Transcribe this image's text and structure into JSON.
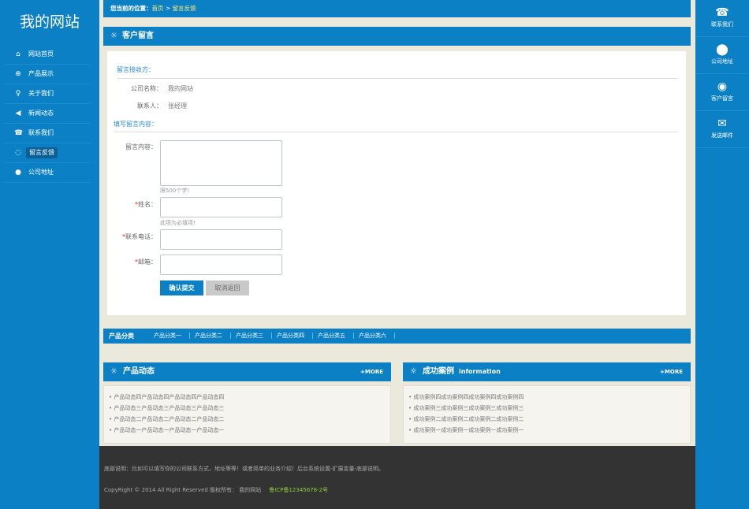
{
  "site": {
    "title": "我的网站"
  },
  "nav": [
    {
      "icon": "home-icon",
      "glyph": "⌂",
      "label": "网站首页"
    },
    {
      "icon": "globe-icon",
      "glyph": "⊕",
      "label": "产品展示"
    },
    {
      "icon": "bulb-icon",
      "glyph": "♀",
      "label": "关于我们"
    },
    {
      "icon": "speaker-icon",
      "glyph": "◀",
      "label": "新闻动态"
    },
    {
      "icon": "phone-icon",
      "glyph": "☎",
      "label": "联系我们"
    },
    {
      "icon": "chat-icon",
      "glyph": "◌",
      "label": "留言反馈",
      "active": true
    },
    {
      "icon": "location-pin-icon",
      "glyph": "●",
      "label": "公司地址"
    }
  ],
  "right_bar": [
    {
      "icon": "phone-icon",
      "glyph": "☎",
      "label": "联系我们"
    },
    {
      "icon": "location-pin-icon",
      "glyph": "⬤",
      "label": "公司地址"
    },
    {
      "icon": "chat-bubble-icon",
      "glyph": "◉",
      "label": "客户留言"
    },
    {
      "icon": "mail-icon",
      "glyph": "✉",
      "label": "发送邮件"
    }
  ],
  "breadcrumb": {
    "prefix": "您当前的位置：",
    "home": "首页",
    "sep": " > ",
    "current": "留言反馈"
  },
  "section": {
    "title": "客户留言"
  },
  "receiver": {
    "heading": "留言接收方：",
    "company_label": "公司名称：",
    "company": "我的网站",
    "contact_label": "联系人：",
    "contact": "张经理"
  },
  "form": {
    "heading": "填写留言内容：",
    "content_label": "留言内容：",
    "content_hint": "限500个字!",
    "name_label": "姓名：",
    "name_hint": "此项为必填项!",
    "phone_label": "联系电话：",
    "email_label": "邮箱：",
    "required_mark": "*",
    "submit": "确认提交",
    "cancel": "取消返回"
  },
  "categories": {
    "title": "产品分类",
    "items": [
      "产品分类一",
      "产品分类二",
      "产品分类三",
      "产品分类四",
      "产品分类五",
      "产品分类六"
    ]
  },
  "news_box": {
    "title": "产品动态",
    "more": "+MORE",
    "items": [
      "产品动态四产品动态四产品动态四产品动态四",
      "产品动态三产品动态三产品动态三产品动态三",
      "产品动态二产品动态二产品动态二产品动态二",
      "产品动态一产品动态一产品动态一产品动态一"
    ]
  },
  "case_box": {
    "title": "成功案例",
    "subtitle": "information",
    "more": "+MORE",
    "items": [
      "成功案例四成功案例四成功案例四成功案例四",
      "成功案例三成功案例三成功案例三成功案例三",
      "成功案例二成功案例二成功案例二成功案例二",
      "成功案例一成功案例一成功案例一成功案例一"
    ]
  },
  "footer": {
    "line1": "底部说明：比如可以填写你的公司联系方式，地址等等！或者简单的业务介绍！后台系统设置-扩展变量-底部说明。",
    "line2": "CopyRight © 2014 All Right Reserved 版权所有：  我的网站",
    "icp": "鲁ICP备12345678-2号"
  },
  "colors": {
    "accent": "#0b80c5",
    "footer_bg": "#333333",
    "icp": "#8cd23c"
  }
}
